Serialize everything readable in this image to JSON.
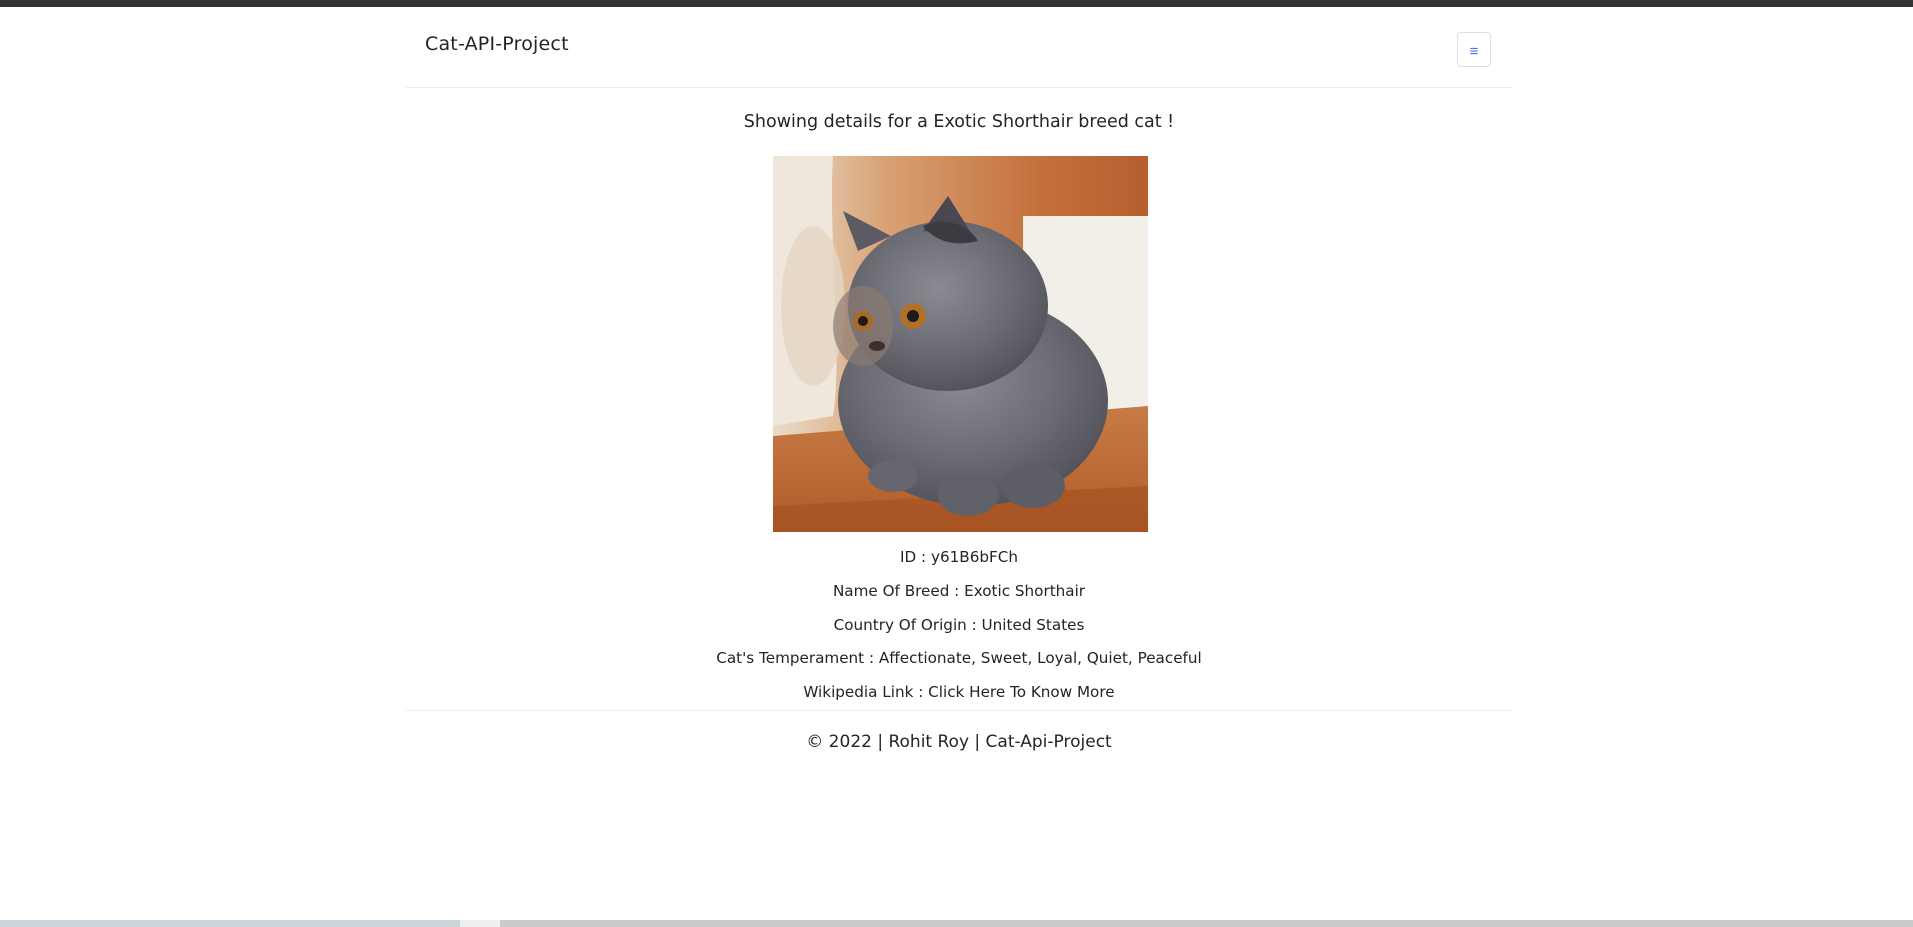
{
  "header": {
    "brand": "Cat-API-Project",
    "menu_icon": "hamburger-icon",
    "menu_glyph": "≡"
  },
  "main": {
    "heading": "Showing details for a Exotic Shorthair breed cat !",
    "image_alt": "Exotic Shorthair cat",
    "details": {
      "id": "ID : y61B6bFCh",
      "breed": "Name Of Breed : Exotic Shorthair",
      "origin": "Country Of Origin : United States",
      "temperament": "Cat's Temperament : Affectionate, Sweet, Loyal, Quiet, Peaceful",
      "wiki_prefix": "Wikipedia Link : ",
      "wiki_link": "Click Here To Know More"
    }
  },
  "footer": {
    "text": "© 2022 | Rohit Roy | Cat-Api-Project"
  },
  "colors": {
    "topbar": "#343434",
    "text": "#212529",
    "divider": "#ececec"
  }
}
